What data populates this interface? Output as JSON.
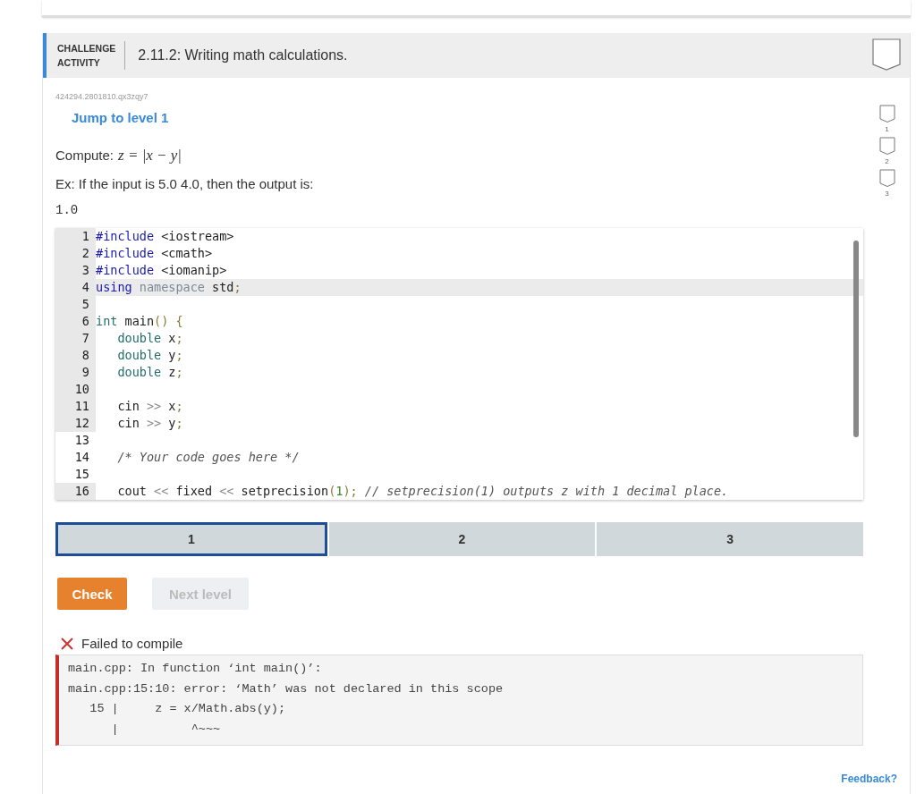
{
  "header": {
    "badge_line_1": "CHALLENGE",
    "badge_line_2": "ACTIVITY",
    "title": "2.11.2: Writing math calculations."
  },
  "activity_id": "424294.2801810.qx3zqy7",
  "jump_link": "Jump to level 1",
  "prompt": {
    "label": "Compute:",
    "formula": "z = |x − y|"
  },
  "example": "Ex: If the input is 5.0 4.0, then the output is:",
  "example_output": "1.0",
  "code_lines": [
    {
      "number": "1",
      "readonly": true,
      "active": false,
      "tokens": [
        {
          "kind": "directive",
          "text": "#include"
        },
        {
          "kind": "plain",
          "text": " <iostream>"
        }
      ]
    },
    {
      "number": "2",
      "readonly": true,
      "active": false,
      "tokens": [
        {
          "kind": "directive",
          "text": "#include"
        },
        {
          "kind": "plain",
          "text": " <cmath>"
        }
      ]
    },
    {
      "number": "3",
      "readonly": true,
      "active": false,
      "tokens": [
        {
          "kind": "directive",
          "text": "#include"
        },
        {
          "kind": "plain",
          "text": " <iomanip>"
        }
      ]
    },
    {
      "number": "4",
      "readonly": true,
      "active": true,
      "tokens": [
        {
          "kind": "keyword",
          "text": "using"
        },
        {
          "kind": "meta",
          "text": " namespace"
        },
        {
          "kind": "plain",
          "text": " std"
        },
        {
          "kind": "punct",
          "text": ";"
        }
      ]
    },
    {
      "number": "5",
      "readonly": true,
      "active": false
    },
    {
      "number": "6",
      "readonly": true,
      "active": false,
      "tokens": [
        {
          "kind": "type",
          "text": "int"
        },
        {
          "kind": "plain",
          "text": " main"
        },
        {
          "kind": "punct",
          "text": "()"
        },
        {
          "kind": "punct",
          "text": " {"
        }
      ]
    },
    {
      "number": "7",
      "readonly": true,
      "active": false,
      "tokens": [
        {
          "kind": "type",
          "text": "   double"
        },
        {
          "kind": "plain",
          "text": " x"
        },
        {
          "kind": "punct",
          "text": ";"
        }
      ]
    },
    {
      "number": "8",
      "readonly": true,
      "active": false,
      "tokens": [
        {
          "kind": "type",
          "text": "   double"
        },
        {
          "kind": "plain",
          "text": " y"
        },
        {
          "kind": "punct",
          "text": ";"
        }
      ]
    },
    {
      "number": "9",
      "readonly": true,
      "active": false,
      "tokens": [
        {
          "kind": "type",
          "text": "   double"
        },
        {
          "kind": "plain",
          "text": " z"
        },
        {
          "kind": "punct",
          "text": ";"
        }
      ]
    },
    {
      "number": "10",
      "readonly": true,
      "active": false
    },
    {
      "number": "11",
      "readonly": true,
      "active": false,
      "tokens": [
        {
          "kind": "plain",
          "text": "   cin"
        },
        {
          "kind": "operator",
          "text": " >>"
        },
        {
          "kind": "plain",
          "text": " x"
        },
        {
          "kind": "punct",
          "text": ";"
        }
      ]
    },
    {
      "number": "12",
      "readonly": true,
      "active": false,
      "tokens": [
        {
          "kind": "plain",
          "text": "   cin"
        },
        {
          "kind": "operator",
          "text": " >>"
        },
        {
          "kind": "plain",
          "text": " y"
        },
        {
          "kind": "punct",
          "text": ";"
        }
      ]
    },
    {
      "number": "13",
      "readonly": false,
      "active": false
    },
    {
      "number": "14",
      "readonly": false,
      "active": false,
      "tokens": [
        {
          "kind": "comment",
          "text": "   /* Your code goes here */"
        }
      ]
    },
    {
      "number": "15",
      "readonly": false,
      "active": false
    },
    {
      "number": "16",
      "readonly": true,
      "active": false,
      "tokens": [
        {
          "kind": "plain",
          "text": "   cout"
        },
        {
          "kind": "operator",
          "text": " <<"
        },
        {
          "kind": "plain",
          "text": " fixed"
        },
        {
          "kind": "operator",
          "text": " <<"
        },
        {
          "kind": "plain",
          "text": " setprecision"
        },
        {
          "kind": "punct",
          "text": "("
        },
        {
          "kind": "number",
          "text": "1"
        },
        {
          "kind": "punct",
          "text": ");"
        },
        {
          "kind": "comment",
          "text": " // setprecision(1) outputs z with 1 decimal place."
        }
      ]
    }
  ],
  "levels": [
    {
      "label": "1",
      "selected": true
    },
    {
      "label": "2",
      "selected": false
    },
    {
      "label": "3",
      "selected": false
    }
  ],
  "check_button": "Check",
  "next_button": {
    "label": "Next level",
    "disabled": true
  },
  "result": {
    "status": "Failed to compile",
    "output": "main.cpp: In function ‘int main()’:\nmain.cpp:15:10: error: ‘Math’ was not declared in this scope\n   15 |     z = x/Math.abs(y);\n      |          ^~~~"
  },
  "progress_levels": [
    {
      "label": "1"
    },
    {
      "label": "2"
    },
    {
      "label": "3"
    }
  ],
  "feedback_link": "Feedback?"
}
